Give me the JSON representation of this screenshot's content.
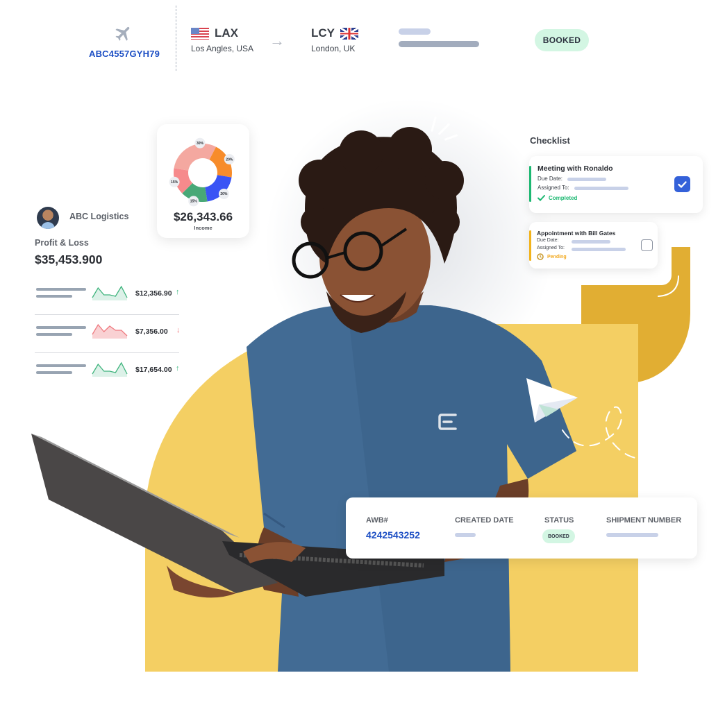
{
  "flight": {
    "icon": "airplane-icon",
    "code": "ABC4557GYH79",
    "origin": {
      "code": "LAX",
      "city": "Los Angles, USA",
      "flag": "us-flag-icon"
    },
    "destination": {
      "code": "LCY",
      "city": "London, UK",
      "flag": "uk-flag-icon"
    },
    "arrow": "→",
    "status": "BOOKED",
    "colors": {
      "code": "#1d4fc4",
      "status_bg": "#d3f6e3"
    }
  },
  "income_card": {
    "amount": "$26,343.66",
    "label": "Income",
    "chart_data": {
      "type": "pie",
      "variant": "donut",
      "slices": [
        {
          "label": "30%",
          "value": 30,
          "color": "#f4a8a0"
        },
        {
          "label": "20%",
          "value": 20,
          "color": "#f78c2b"
        },
        {
          "label": "20%",
          "value": 20,
          "color": "#3a54f5"
        },
        {
          "label": "15%",
          "value": 15,
          "color": "#48a877"
        },
        {
          "label": "15%",
          "value": 15,
          "color": "#f68a8c"
        }
      ]
    }
  },
  "profit_loss": {
    "company": "ABC Logistics",
    "avatar": "company-avatar",
    "label": "Profit & Loss",
    "amount": "$35,453.900",
    "rows": [
      {
        "value": "$12,356.90",
        "trend": "up",
        "arrow": "↑",
        "spark": [
          2,
          9,
          4,
          4,
          3,
          10,
          2
        ]
      },
      {
        "value": "$7,356.00",
        "trend": "down",
        "arrow": "↓",
        "spark": [
          3,
          10,
          5,
          9,
          6,
          6,
          2
        ]
      },
      {
        "value": "$17,654.00",
        "trend": "up",
        "arrow": "↑",
        "spark": [
          2,
          9,
          4,
          4,
          3,
          10,
          2
        ]
      }
    ]
  },
  "checklist": {
    "title": "Checklist",
    "tasks": [
      {
        "title": "Meeting with Ronaldo",
        "due_label": "Due Date:",
        "assigned_label": "Assigned To:",
        "status": "Completed",
        "status_icon": "checkmark-icon",
        "checked": true,
        "accent": "#1db872"
      },
      {
        "title": "Appointment with Bill Gates",
        "due_label": "Due Date:",
        "assigned_label": "Assigned To:",
        "status": "Pending",
        "status_icon": "clock-icon",
        "checked": false,
        "accent": "#f2b31c"
      }
    ]
  },
  "shipment": {
    "headers": [
      "AWB#",
      "CREATED DATE",
      "STATUS",
      "SHIPMENT NUMBER"
    ],
    "awb_number": "4242543252",
    "status": "BOOKED"
  },
  "decor": {
    "shirt_logo": "brand-logo-icon",
    "paper_plane": "paper-plane-icon",
    "brand_yellow": "#f4cf63",
    "brand_gold": "#e1ae33"
  }
}
